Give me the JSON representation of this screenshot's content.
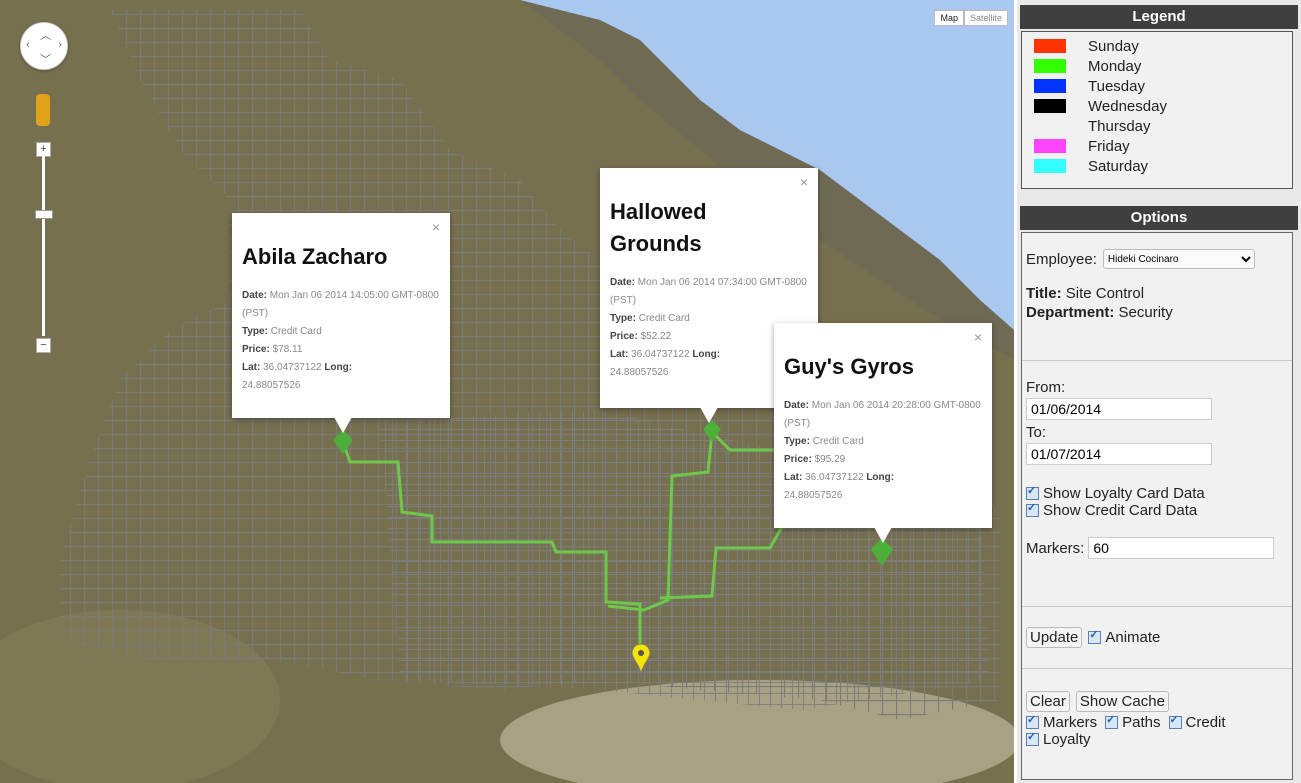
{
  "map": {
    "map_type_buttons": [
      "Map",
      "Satellite"
    ],
    "markers": [
      {
        "name": "Abila Zacharo",
        "date": "Mon Jan 06 2014 14:05:00 GMT-0800 (PST)",
        "type": "Credit Card",
        "price": "$78.11",
        "lat": "36.04737122",
        "long": "24.88057526"
      },
      {
        "name": "Hallowed Grounds",
        "date": "Mon Jan 06 2014 07:34:00 GMT-0800 (PST)",
        "type": "Credit Card",
        "price": "$52.22",
        "lat": "36.04737122",
        "long": "24.88057526"
      },
      {
        "name": "Guy's Gyros",
        "date": "Mon Jan 06 2014 20:28:00 GMT-0800 (PST)",
        "type": "Credit Card",
        "price": "$95.29",
        "lat": "36.04737122",
        "long": "24.88057526"
      }
    ],
    "labels": {
      "date": "Date:",
      "type": "Type:",
      "price": "Price:",
      "lat": "Lat:",
      "long": "Long:"
    },
    "path_color": "#6ec84a",
    "home_marker_color": "#f2e500"
  },
  "legend": {
    "title": "Legend",
    "items": [
      {
        "label": "Sunday",
        "color": "#ff3300"
      },
      {
        "label": "Monday",
        "color": "#33ff00"
      },
      {
        "label": "Tuesday",
        "color": "#0033ff"
      },
      {
        "label": "Wednesday",
        "color": "#000000"
      },
      {
        "label": "Thursday",
        "color": "#f1f1f1"
      },
      {
        "label": "Friday",
        "color": "#ff44ff"
      },
      {
        "label": "Saturday",
        "color": "#33ffff"
      }
    ]
  },
  "options": {
    "title": "Options",
    "employee_label": "Employee:",
    "employee_value": "Hideki Cocinaro",
    "title_label": "Title:",
    "title_value": "Site Control",
    "department_label": "Department:",
    "department_value": "Security",
    "from_label": "From:",
    "from_value": "01/06/2014",
    "to_label": "To:",
    "to_value": "01/07/2014",
    "show_loyalty": "Show Loyalty Card Data",
    "show_credit": "Show Credit Card Data",
    "markers_label": "Markers:",
    "markers_value": "60",
    "update_button": "Update",
    "animate_label": "Animate",
    "clear_button": "Clear",
    "show_cache_button": "Show Cache",
    "filter_markers": "Markers",
    "filter_paths": "Paths",
    "filter_credit": "Credit",
    "filter_loyalty": "Loyalty"
  }
}
